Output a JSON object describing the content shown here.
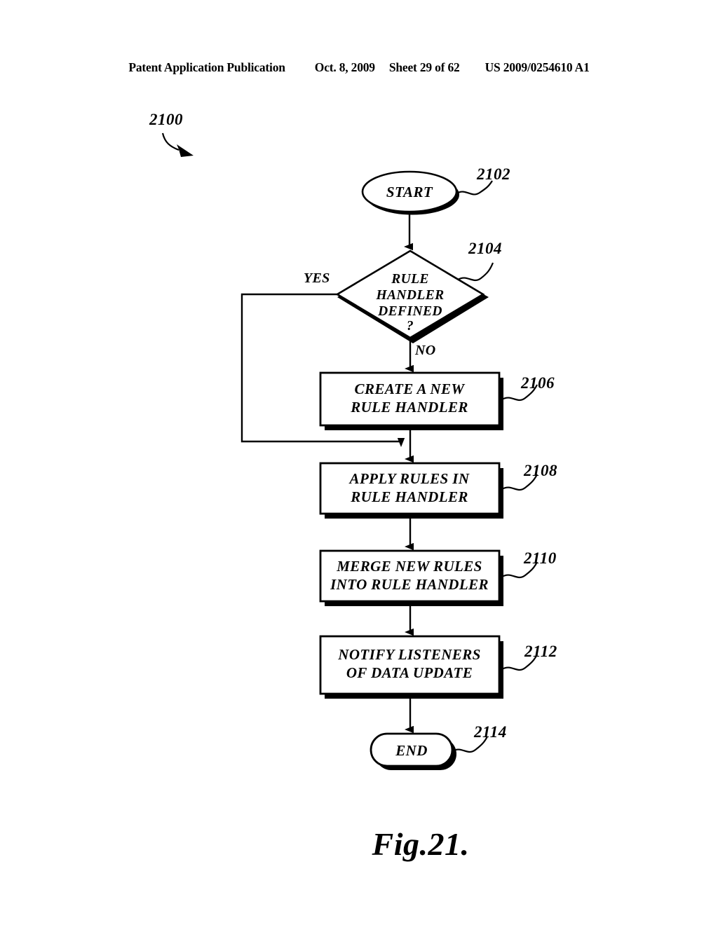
{
  "header": {
    "publication": "Patent Application Publication",
    "date": "Oct. 8, 2009",
    "sheet": "Sheet 29 of 62",
    "number": "US 2009/0254610 A1"
  },
  "figure": {
    "caption": "Fig.21.",
    "diagram_ref": "2100",
    "colors": {
      "ink": "#000000",
      "paper": "#ffffff"
    },
    "nodes": [
      {
        "id": "start",
        "type": "terminator-ellipse",
        "label": "START",
        "ref": "2102"
      },
      {
        "id": "decision",
        "type": "decision-diamond",
        "label_line1": "RULE",
        "label_line2": "HANDLER",
        "label_line3": "DEFINED",
        "label_line4": "?",
        "ref": "2104",
        "branch_yes": "YES",
        "branch_no": "NO"
      },
      {
        "id": "create",
        "type": "process-box",
        "label_line1": "CREATE A NEW",
        "label_line2": "RULE HANDLER",
        "ref": "2106"
      },
      {
        "id": "apply",
        "type": "process-box",
        "label_line1": "APPLY RULES IN",
        "label_line2": "RULE HANDLER",
        "ref": "2108"
      },
      {
        "id": "merge",
        "type": "process-box",
        "label_line1": "MERGE NEW RULES",
        "label_line2": "INTO RULE HANDLER",
        "ref": "2110"
      },
      {
        "id": "notify",
        "type": "process-box",
        "label_line1": "NOTIFY LISTENERS",
        "label_line2": "OF DATA UPDATE",
        "ref": "2112"
      },
      {
        "id": "end",
        "type": "terminator-stadium",
        "label": "END",
        "ref": "2114"
      }
    ]
  }
}
